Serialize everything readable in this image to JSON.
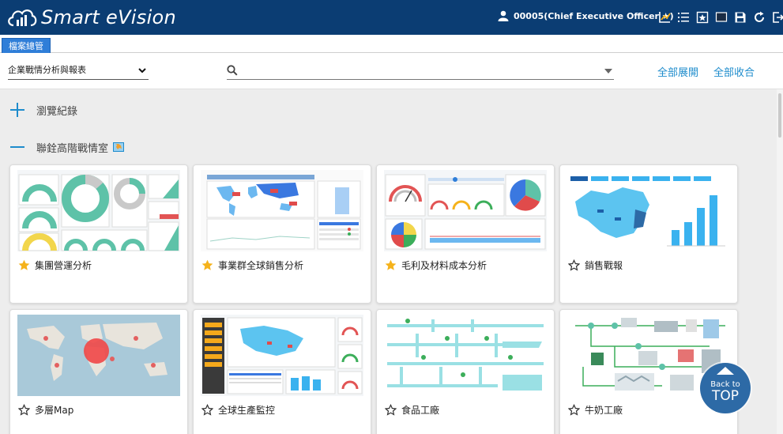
{
  "app": {
    "title": "Smart eVision"
  },
  "header": {
    "user": "00005(Chief Executive Officer ★)"
  },
  "toolbar_icons": [
    "chart-icon",
    "list-icon",
    "bookmark-icon",
    "screen-icon",
    "save-icon",
    "refresh-icon",
    "logout-icon"
  ],
  "tab": {
    "label": "檔案總管"
  },
  "filters": {
    "category_select": "企業戰情分析與報表",
    "search_placeholder": "",
    "expand_all": "全部展開",
    "collapse_all": "全部收合"
  },
  "sections": [
    {
      "label": "瀏覽紀錄",
      "expanded": false
    },
    {
      "label": "聯銓高階戰情室",
      "expanded": true
    }
  ],
  "cards": [
    {
      "label": "集團營運分析",
      "favorite": true,
      "thumb": "gauges"
    },
    {
      "label": "事業群全球銷售分析",
      "favorite": true,
      "thumb": "worldmap"
    },
    {
      "label": "毛利及材料成本分析",
      "favorite": true,
      "thumb": "pies"
    },
    {
      "label": "銷售戰報",
      "favorite": false,
      "thumb": "chinamap"
    },
    {
      "label": "多層Map",
      "favorite": false,
      "thumb": "map"
    },
    {
      "label": "全球生產監控",
      "favorite": false,
      "thumb": "production"
    },
    {
      "label": "食品工廠",
      "favorite": false,
      "thumb": "factory"
    },
    {
      "label": "牛奶工廠",
      "favorite": false,
      "thumb": "milk"
    }
  ],
  "back_to_top": {
    "line1": "Back to",
    "line2": "TOP"
  },
  "colors": {
    "header": "#0b3d73",
    "accent": "#1e8ccc",
    "star": "#f5b21b"
  }
}
